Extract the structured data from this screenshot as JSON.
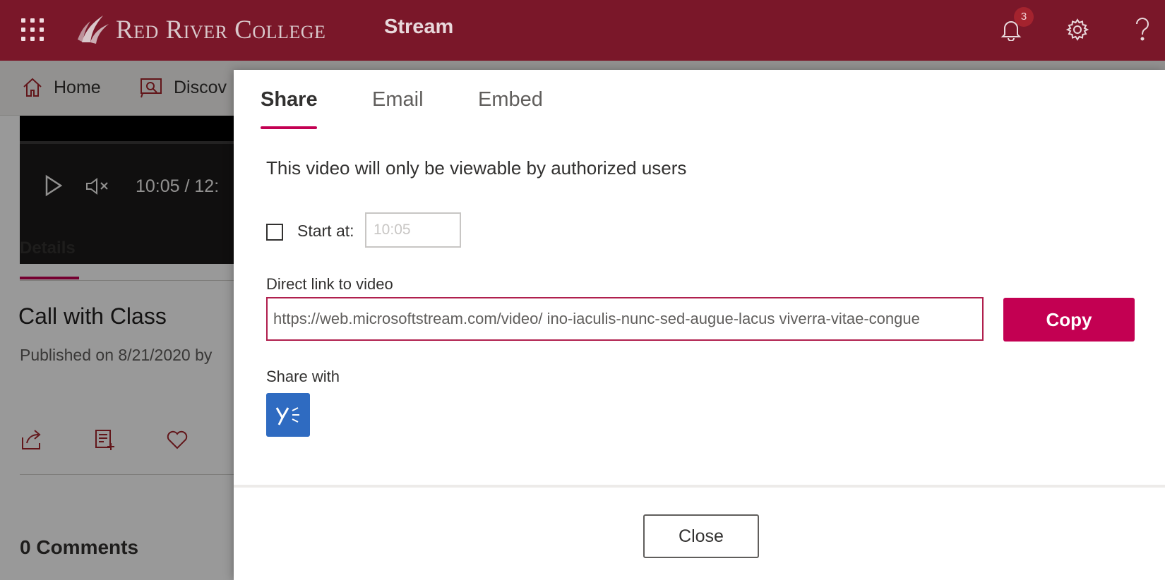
{
  "header": {
    "college_name": "Red River College",
    "app_name": "Stream",
    "notification_count": "3",
    "icons": [
      "app-launcher-icon",
      "bell-icon",
      "gear-icon",
      "help-icon"
    ],
    "brand_color": "#7a1729"
  },
  "nav": {
    "items": [
      {
        "label": "Home",
        "icon": "home-icon"
      },
      {
        "label": "Discov",
        "icon": "discover-icon"
      }
    ]
  },
  "player": {
    "time": "10:05  /  12:"
  },
  "details": {
    "tab_label": "Details",
    "video_title": "Call with Class",
    "published": "Published on 8/21/2020 by",
    "comments": "0 Comments",
    "actions": [
      "share-icon",
      "add-to-playlist-icon",
      "like-icon"
    ]
  },
  "dialog": {
    "tabs": [
      {
        "label": "Share",
        "active": true
      },
      {
        "label": "Email",
        "active": false
      },
      {
        "label": "Embed",
        "active": false
      }
    ],
    "notice": "This video will only be viewable by authorized users",
    "start_at_label": "Start at:",
    "start_at_checked": false,
    "start_at_value": "10:05",
    "link_label": "Direct link to video",
    "link_value": "https://web.microsoftstream.com/video/ ino-iaculis-nunc-sed-augue-lacus viverra-vitae-congue",
    "copy_label": "Copy",
    "share_with_label": "Share with",
    "share_targets": [
      "yammer-icon"
    ],
    "close_label": "Close",
    "accent_color": "#c30052"
  }
}
